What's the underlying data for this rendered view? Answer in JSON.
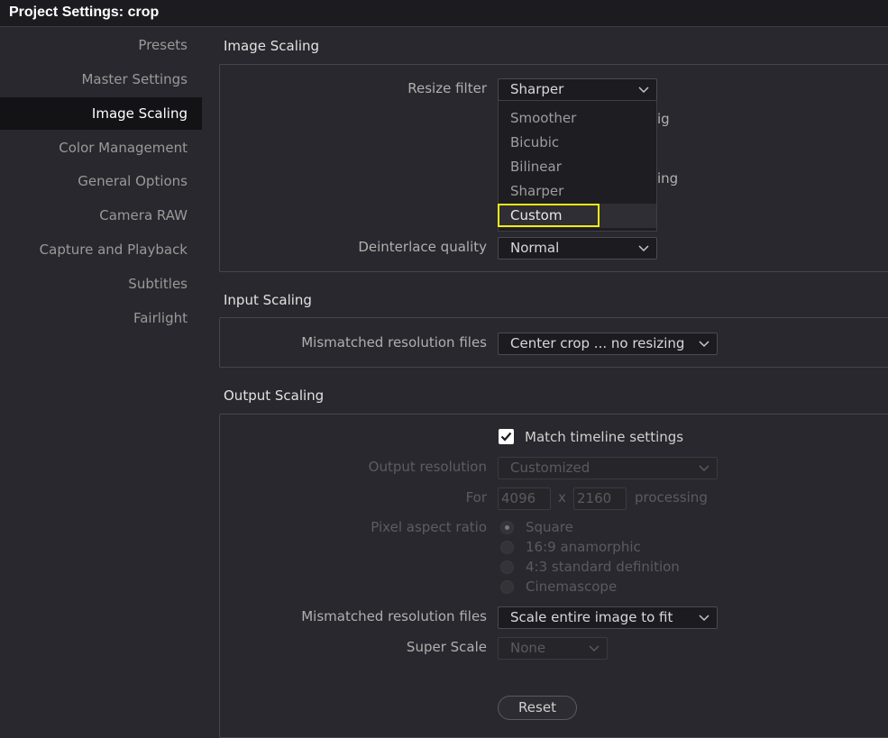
{
  "window": {
    "title": "Project Settings:  crop"
  },
  "sidebar": {
    "items": [
      {
        "label": "Presets"
      },
      {
        "label": "Master Settings"
      },
      {
        "label": "Image Scaling"
      },
      {
        "label": "Color Management"
      },
      {
        "label": "General Options"
      },
      {
        "label": "Camera RAW"
      },
      {
        "label": "Capture and Playback"
      },
      {
        "label": "Subtitles"
      },
      {
        "label": "Fairlight"
      }
    ],
    "active_index": 2
  },
  "image_scaling": {
    "title": "Image Scaling",
    "resize_filter_label": "Resize filter",
    "resize_filter_value": "Sharper",
    "resize_filter_options": [
      "Smoother",
      "Bicubic",
      "Bilinear",
      "Sharper",
      "Custom"
    ],
    "highlighted_option": "Custom",
    "obscured_text_1": "ig",
    "obscured_text_2": "ing",
    "deinterlace_label": "Deinterlace quality",
    "deinterlace_value": "Normal"
  },
  "input_scaling": {
    "title": "Input Scaling",
    "mismatched_label": "Mismatched resolution files",
    "mismatched_value": "Center crop ... no resizing"
  },
  "output_scaling": {
    "title": "Output Scaling",
    "match_timeline_label": "Match timeline settings",
    "match_timeline_checked": true,
    "output_resolution_label": "Output resolution",
    "output_resolution_value": "Customized",
    "for_label": "For",
    "width": "4096",
    "x_sep": "x",
    "height": "2160",
    "processing_label": "processing",
    "par_label": "Pixel aspect ratio",
    "par_options": [
      "Square",
      "16:9 anamorphic",
      "4:3 standard definition",
      "Cinemascope"
    ],
    "par_selected": "Square",
    "mismatched_label": "Mismatched resolution files",
    "mismatched_value": "Scale entire image to fit",
    "super_scale_label": "Super Scale",
    "super_scale_value": "None",
    "reset_label": "Reset"
  },
  "colors": {
    "background": "#28282e",
    "titlebar": "#1c1c20",
    "active_item": "#131316",
    "highlight_outline": "#f2ec16"
  }
}
